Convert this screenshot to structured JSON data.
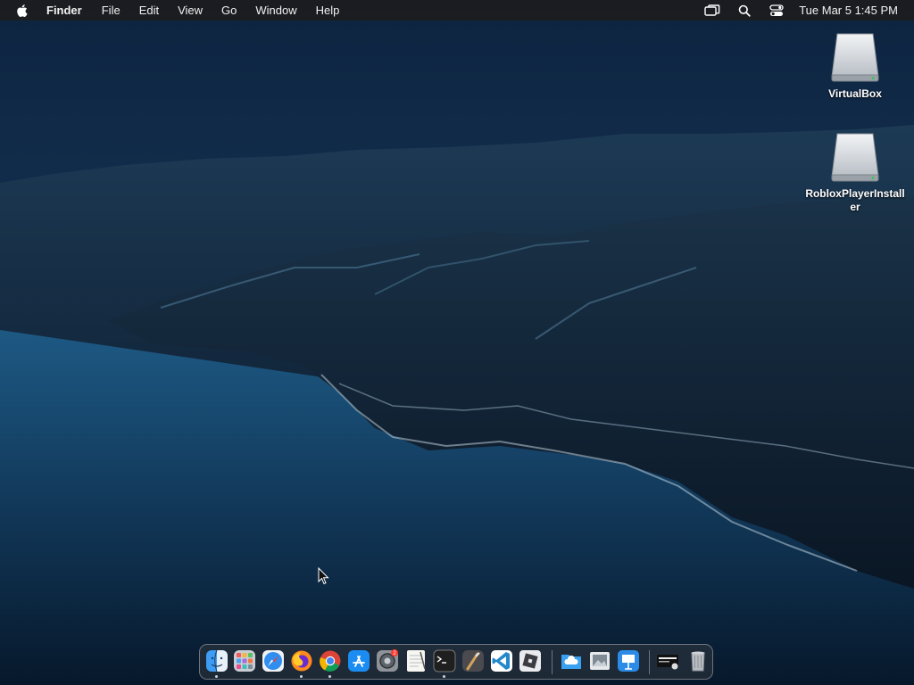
{
  "menubar": {
    "app_name": "Finder",
    "menus": [
      "File",
      "Edit",
      "View",
      "Go",
      "Window",
      "Help"
    ],
    "clock": "Tue Mar 5  1:45 PM"
  },
  "desktop": {
    "icons": [
      {
        "label": "VirtualBox",
        "icon": "drive-icon"
      },
      {
        "label": "RobloxPlayerInstaller",
        "icon": "drive-icon"
      }
    ]
  },
  "dock": {
    "items": [
      {
        "name": "finder",
        "running": true
      },
      {
        "name": "launchpad",
        "running": false
      },
      {
        "name": "safari",
        "running": false
      },
      {
        "name": "firefox",
        "running": true
      },
      {
        "name": "chrome",
        "running": true
      },
      {
        "name": "app-store",
        "running": false
      },
      {
        "name": "system-settings",
        "running": false,
        "badge": "2"
      },
      {
        "name": "textedit",
        "running": false
      },
      {
        "name": "terminal",
        "running": true
      },
      {
        "name": "instruments",
        "running": false
      },
      {
        "name": "vscode",
        "running": false
      },
      {
        "name": "roblox",
        "running": false
      },
      {
        "name": "icloud-folder",
        "running": false
      },
      {
        "name": "preview",
        "running": false
      },
      {
        "name": "keynote",
        "running": false
      },
      {
        "name": "screen-capture",
        "running": false
      },
      {
        "name": "trash",
        "running": false
      }
    ]
  },
  "colors": {
    "menubar_bg": "#1c1c1e",
    "sea": "#1c4d78",
    "sky": "#12304f"
  }
}
